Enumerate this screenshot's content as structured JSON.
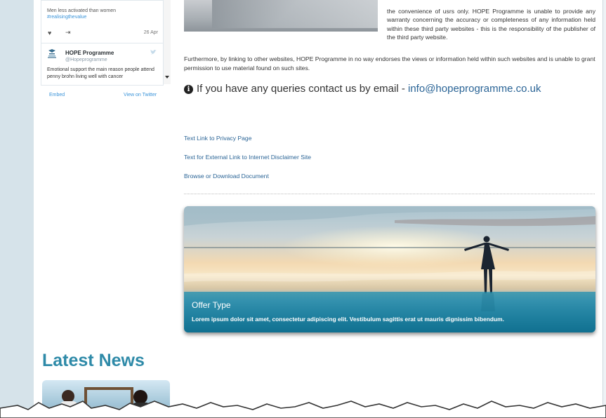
{
  "twitter": {
    "tweet1_text": "Men less activated than women",
    "tweet1_hashtag": "#realisingthevalue",
    "tweet1_date": "26 Apr",
    "tweet2_name": "HOPE Programme",
    "tweet2_handle": "@Hopeprogramme",
    "tweet2_text": "Emotional support the main reason people attend penny brohn living well with cancer",
    "embed_label": "Embed",
    "view_label": "View on Twitter"
  },
  "main": {
    "disclaimer_text": "the convenience of usrs only. HOPE Programme is unable to provide any warranty concerning the accuracy or completeness of any information held within these third party websites - this is the responsibility of the publisher of the third party website.",
    "paragraph2": "Furthermore, by linking to other websites, HOPE Programme in no way endorses the views or information held within such websites and is unable to grant permission to use material found on such sites.",
    "contact_text": "If you have any queries contact us by email - ",
    "contact_email": "info@hopeprogramme.co.uk",
    "links": [
      "Text Link to Privacy Page",
      "Text for External Link to Internet Disclaimer Site",
      "Browse or Download Document"
    ]
  },
  "offer": {
    "title": "Offer Type",
    "description": "Lorem ipsum dolor sit amet, consectetur adipiscing elit. Vestibulum sagittis erat ut mauris dignissim bibendum."
  },
  "news": {
    "heading": "Latest News"
  },
  "colors": {
    "link": "#2a6496",
    "heading": "#2e8aa8",
    "twitter_blue": "#3b94d9"
  }
}
